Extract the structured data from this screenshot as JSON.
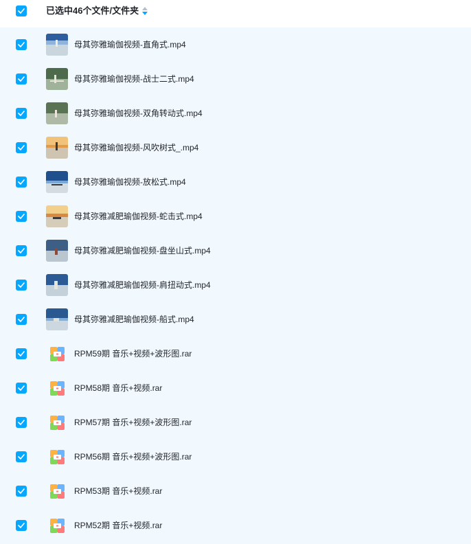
{
  "header": {
    "title": "已选中46个文件/文件夹"
  },
  "colors": {
    "accent": "#06a7ff",
    "list_background": "#f1f9ff"
  },
  "files": [
    {
      "name": "母其弥雅瑜伽视频-直角式.mp4",
      "kind": "video",
      "checked": true
    },
    {
      "name": "母其弥雅瑜伽视频-战士二式.mp4",
      "kind": "video",
      "checked": true
    },
    {
      "name": "母其弥雅瑜伽视频-双角转动式.mp4",
      "kind": "video",
      "checked": true
    },
    {
      "name": "母其弥雅瑜伽视频-风吹树式_.mp4",
      "kind": "video",
      "checked": true
    },
    {
      "name": "母其弥雅瑜伽视频-放松式.mp4",
      "kind": "video",
      "checked": true
    },
    {
      "name": "母其弥雅减肥瑜伽视频-蛇击式.mp4",
      "kind": "video",
      "checked": true
    },
    {
      "name": "母其弥雅减肥瑜伽视频-盘坐山式.mp4",
      "kind": "video",
      "checked": true
    },
    {
      "name": "母其弥雅减肥瑜伽视频-肩扭动式.mp4",
      "kind": "video",
      "checked": true
    },
    {
      "name": "母其弥雅减肥瑜伽视频-船式.mp4",
      "kind": "video",
      "checked": true
    },
    {
      "name": "RPM59期 音乐+视频+波形图.rar",
      "kind": "archive",
      "checked": true
    },
    {
      "name": "RPM58期 音乐+视频.rar",
      "kind": "archive",
      "checked": true
    },
    {
      "name": "RPM57期 音乐+视频+波形图.rar",
      "kind": "archive",
      "checked": true
    },
    {
      "name": "RPM56期 音乐+视频+波形图.rar",
      "kind": "archive",
      "checked": true
    },
    {
      "name": "RPM53期 音乐+视频.rar",
      "kind": "archive",
      "checked": true
    },
    {
      "name": "RPM52期 音乐+视频.rar",
      "kind": "archive",
      "checked": true
    }
  ]
}
